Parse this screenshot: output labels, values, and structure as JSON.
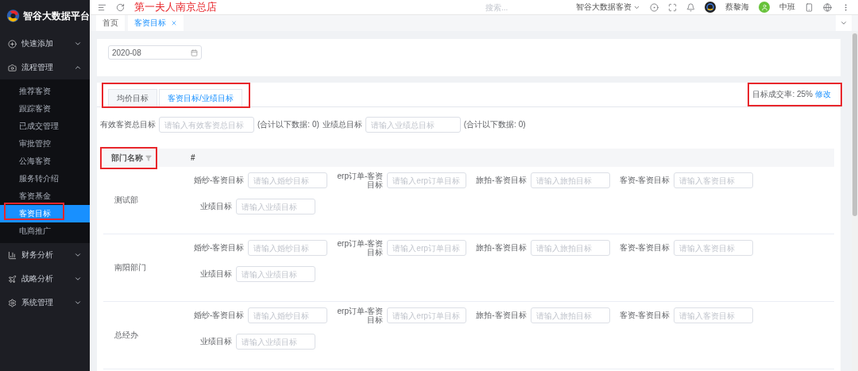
{
  "sidebar": {
    "logo_text": "智谷大数据平台",
    "items": [
      {
        "label": "快速添加",
        "expanded": false
      },
      {
        "label": "流程管理",
        "expanded": true,
        "children": [
          {
            "label": "推荐客资",
            "selected": false,
            "highlighted": false
          },
          {
            "label": "跟踪客资",
            "selected": false,
            "highlighted": false
          },
          {
            "label": "已成交管理",
            "selected": false,
            "highlighted": false
          },
          {
            "label": "审批管控",
            "selected": false,
            "highlighted": false
          },
          {
            "label": "公海客资",
            "selected": false,
            "highlighted": false
          },
          {
            "label": "服务转介绍",
            "selected": false,
            "highlighted": false
          },
          {
            "label": "客资基金",
            "selected": false,
            "highlighted": false
          },
          {
            "label": "客资目标",
            "selected": true,
            "highlighted": true
          },
          {
            "label": "电商推广",
            "selected": false,
            "highlighted": false
          }
        ]
      },
      {
        "label": "财务分析",
        "expanded": false
      },
      {
        "label": "战略分析",
        "expanded": false
      },
      {
        "label": "系统管理",
        "expanded": false
      }
    ]
  },
  "header": {
    "title": "第一夫人南京总店",
    "search_placeholder": "搜索...",
    "org": "智谷大数据客资",
    "user": "蔡黎海",
    "shift": "中班"
  },
  "tabs": [
    {
      "label": "首页",
      "selected": false,
      "closable": false
    },
    {
      "label": "客资目标",
      "selected": true,
      "closable": true
    }
  ],
  "date_field": {
    "value": "2020-08"
  },
  "target_tabs": {
    "highlighted": true,
    "items": [
      {
        "label": "均价目标",
        "selected": false
      },
      {
        "label": "客资目标/业绩目标",
        "selected": true
      }
    ]
  },
  "rate": {
    "highlighted": true,
    "label": "目标成交率: 25%",
    "link": "修改"
  },
  "totals": [
    {
      "label": "有效客资总目标",
      "placeholder": "请输入有效客资总目标",
      "note": "(合计以下数据: 0)"
    },
    {
      "label": "业绩总目标",
      "placeholder": "请输入业绩总目标",
      "note": "(合计以下数据: 0)"
    }
  ],
  "table": {
    "columns": [
      {
        "label": "部门名称",
        "filter": true,
        "highlighted": true
      },
      {
        "label": "#",
        "filter": false,
        "highlighted": false
      }
    ],
    "rows": [
      {
        "department": "测试部",
        "lines": [
          {
            "fields": [
              {
                "label": "婚纱-客资目标",
                "placeholder": "请输入婚纱目标"
              },
              {
                "label": "erp订单-客资目标",
                "placeholder": "请输入erp订单目标"
              },
              {
                "label": "旅拍-客资目标",
                "placeholder": "请输入旅拍目标"
              },
              {
                "label": "客资-客资目标",
                "placeholder": "请输入客资目标"
              }
            ]
          },
          {
            "fields": [
              {
                "label": "业绩目标",
                "placeholder": "请输入业绩目标"
              }
            ]
          }
        ]
      },
      {
        "department": "南阳部门",
        "lines": [
          {
            "fields": [
              {
                "label": "婚纱-客资目标",
                "placeholder": "请输入婚纱目标"
              },
              {
                "label": "erp订单-客资目标",
                "placeholder": "请输入erp订单目标"
              },
              {
                "label": "旅拍-客资目标",
                "placeholder": "请输入旅拍目标"
              },
              {
                "label": "客资-客资目标",
                "placeholder": "请输入客资目标"
              }
            ]
          },
          {
            "fields": [
              {
                "label": "业绩目标",
                "placeholder": "请输入业绩目标"
              }
            ]
          }
        ]
      },
      {
        "department": "总经办",
        "lines": [
          {
            "fields": [
              {
                "label": "婚纱-客资目标",
                "placeholder": "请输入婚纱目标"
              },
              {
                "label": "erp订单-客资目标",
                "placeholder": "请输入erp订单目标"
              },
              {
                "label": "旅拍-客资目标",
                "placeholder": "请输入旅拍目标"
              },
              {
                "label": "客资-客资目标",
                "placeholder": "请输入客资目标"
              }
            ]
          },
          {
            "fields": [
              {
                "label": "业绩目标",
                "placeholder": "请输入业绩目标"
              }
            ]
          }
        ]
      }
    ]
  }
}
